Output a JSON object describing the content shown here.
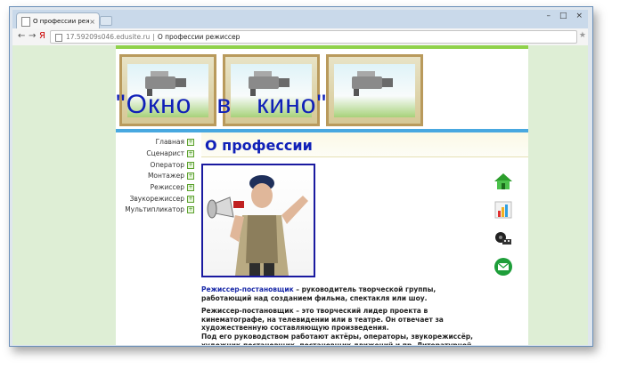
{
  "browser": {
    "tab_title": "О профессии режисс",
    "tab_close": "×",
    "url": "17.59209s046.edusite.ru",
    "page_title": "О профессии режиссер",
    "separator": "|",
    "back_icon": "←",
    "forward_icon": "→",
    "yandex_icon": "Я",
    "reload_icon": "C",
    "star_icon": "★",
    "minimize": "–",
    "maximize": "□",
    "close": "×"
  },
  "site": {
    "title": "\"Окно   в   кино\"",
    "nav": [
      {
        "label": "Главная"
      },
      {
        "label": "Сценарист"
      },
      {
        "label": "Оператор"
      },
      {
        "label": "Монтажер"
      },
      {
        "label": "Режиссер"
      },
      {
        "label": "Звукорежиссер"
      },
      {
        "label": "Мультипликатор"
      }
    ],
    "nav_plus": "+",
    "side_icons": [
      "home-icon",
      "chart-icon",
      "film-reel-icon",
      "mail-icon"
    ]
  },
  "content": {
    "heading": "О профессии",
    "para1_lead": "Режиссер-постановщик",
    "para1_rest": " – руководитель творческой группы, работающий над созданием фильма, спектакля или шоу.",
    "para2": "Режиссер-постановщик – это творческий лидер проекта в кинематографе, на телевидении или в театре. Он отвечает за художественную составляющую произведения.",
    "para3": "Под его руководством работают актёры, операторы, звукорежиссёр, художник-постановщик, постановщик движений и пр. Литературной основой"
  },
  "colors": {
    "accent_blue": "#1020b8",
    "top_green": "#8fd24a",
    "divider_blue": "#48a8e0",
    "page_bg": "#deeed5"
  }
}
